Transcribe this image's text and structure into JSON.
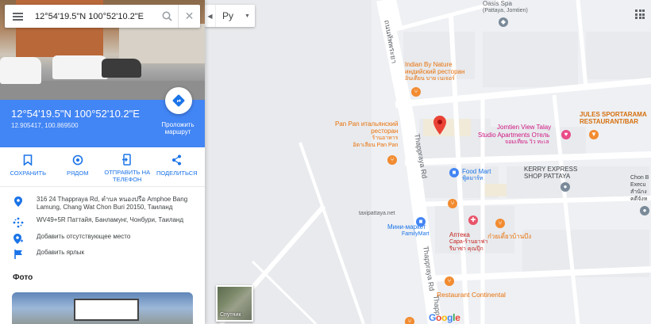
{
  "search": {
    "value": "12°54'19.5\"N 100°52'10.2\"E"
  },
  "header": {
    "title": "12°54'19.5\"N 100°52'10.2\"E",
    "decimal": "12.905417, 100.869500",
    "directions_label": "Проложить маршрут"
  },
  "actions": [
    {
      "label": "СОХРАНИТЬ"
    },
    {
      "label": "РЯДОМ"
    },
    {
      "label": "ОТПРАВИТЬ НА ТЕЛЕФОН"
    },
    {
      "label": "ПОДЕЛИТЬСЯ"
    }
  ],
  "info": {
    "address": "316 24 Thappraya Rd, ตำบล หนองปรือ Amphoe Bang Lamung, Chang Wat Chon Buri 20150, Таиланд",
    "pluscode": "WV49+5R Паттайя, Банламунг, Чонбури, Таиланд",
    "add_place": "Добавить отсутствующее место",
    "add_label": "Добавить ярлык"
  },
  "photos_heading": "Фото",
  "map": {
    "language": "Ру",
    "satellite_label": "Спутник",
    "google_logo": "Google",
    "pois": {
      "oasis_spa": "Oasis Spa",
      "oasis_spa_sub": "(Pattaya, Jomtien)",
      "indian": "Indian By Nature",
      "indian_ru": "индийский ресторан",
      "indian_th": "อินเดียน บาย เนเจอร์",
      "panpan": "Pan Pan итальянский",
      "panpan2": "ресторан",
      "panpan_th1": "ร้านอาหาร",
      "panpan_th2": "อิตาเลียน Pan Pan",
      "jules1": "JULES SPORTARAMA",
      "jules2": "RESTAURANT/BAR",
      "jomtien_view": "Jomtien View Talay",
      "studio": "Studio Apartments Отель",
      "jomtien_view_th": "จอมเทียน วิว ทะเล",
      "foodmart": "Food Mart",
      "foodmart_th": "ฟู้ดมาร์ท",
      "kerry1": "KERRY EXPRESS",
      "kerry2": "SHOP PATTAYA",
      "chon1": "Chon B",
      "chon2": "Execu",
      "chon3": "สำนักง",
      "chon4": "คดีจังห",
      "taxi": "taxipattaya.net",
      "mini": "Мини-маркет",
      "mini_sub": "FamilyMart",
      "apteka": "Аптека",
      "apteka2": "Сара-ร้านยาฟา",
      "apteka3": "รีมาซ่า คุณปุ๊ก",
      "noodle": "ก๋วยเตี๋ยวบ้านบึง",
      "continental": "Restaurant Continental"
    },
    "roads": {
      "thappraya_th": "ถนนทัพพระยา",
      "thappraya1": "Thappraya Rd",
      "thappraya2": "Thappraya Rd",
      "thappraya3": "Thapp"
    }
  }
}
